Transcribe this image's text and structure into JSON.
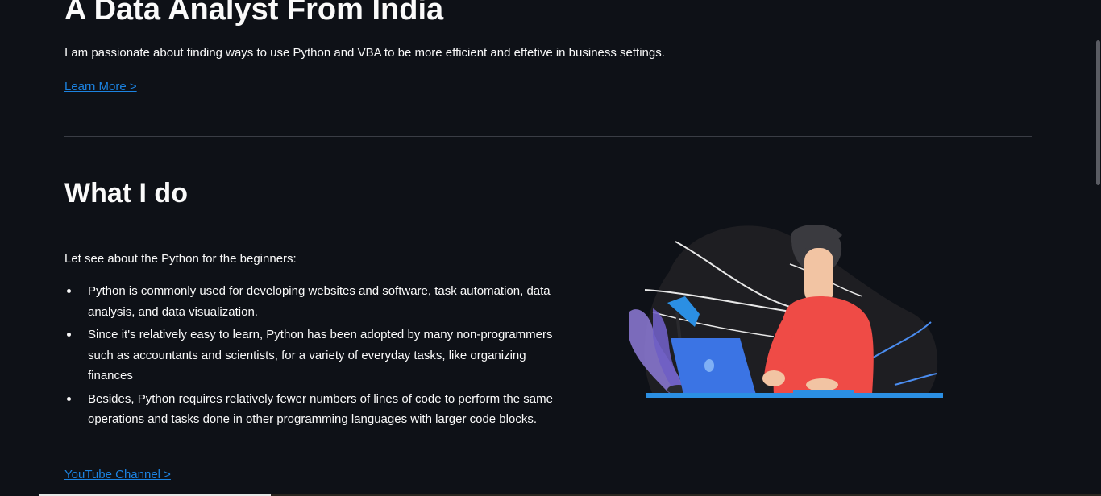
{
  "hero": {
    "title": "A Data Analyst From India",
    "description": "I am passionate about finding ways to use Python and VBA to be more efficient and effetive in business settings.",
    "link_label": "Learn More >"
  },
  "what_i_do": {
    "title": "What I do",
    "intro": "Let see about the Python for the beginners:",
    "bullets": [
      "Python is commonly used for developing websites and software, task automation, data analysis, and data visualization.",
      "Since it's relatively easy to learn, Python has been adopted by many non-programmers such as accountants and scientists, for a variety of everyday tasks, like organizing finances",
      "Besides, Python requires relatively fewer numbers of lines of code to perform the same operations and tasks done in other programming languages with larger code blocks."
    ],
    "link_label": "YouTube Channel >"
  },
  "colors": {
    "background": "#0e1117",
    "link": "#1c83e1",
    "text": "#fafafa"
  }
}
